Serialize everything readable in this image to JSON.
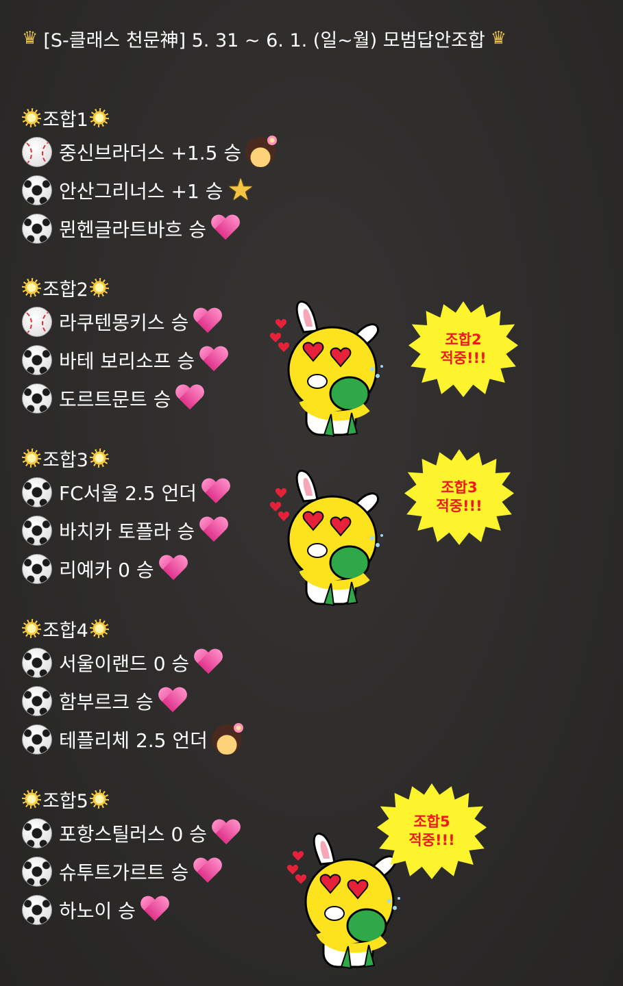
{
  "header": {
    "title": "[S-클래스 천문神] 5. 31 ~ 6. 1. (일~월) 모범답안조합"
  },
  "colors": {
    "background": "#2e2d2c",
    "text": "#ffffff",
    "burst": "#fef42d",
    "burst_text": "#ee1a1a",
    "heart": "#e0328a"
  },
  "sections": [
    {
      "label": "조합1",
      "picks": [
        {
          "sport": "baseball",
          "text": "중신브라더스 +1.5 승",
          "emoji": "girl-emoji"
        },
        {
          "sport": "soccer",
          "text": "안산그리너스 +1 승",
          "emoji": "star-emoji"
        },
        {
          "sport": "soccer",
          "text": "뮌헨글라트바흐 승",
          "emoji": "heart-emoji"
        }
      ]
    },
    {
      "label": "조합2",
      "picks": [
        {
          "sport": "baseball",
          "text": "라쿠텐몽키스 승",
          "emoji": "heart-emoji"
        },
        {
          "sport": "soccer",
          "text": "바테 보리소프 승",
          "emoji": "heart-emoji"
        },
        {
          "sport": "soccer",
          "text": "도르트문트 승",
          "emoji": "heart-emoji"
        }
      ]
    },
    {
      "label": "조합3",
      "picks": [
        {
          "sport": "soccer",
          "text": "FC서울 2.5 언더",
          "emoji": "heart-emoji"
        },
        {
          "sport": "soccer",
          "text": "바치카 토플라 승",
          "emoji": "heart-emoji"
        },
        {
          "sport": "soccer",
          "text": "리예카 0 승",
          "emoji": "heart-emoji"
        }
      ]
    },
    {
      "label": "조합4",
      "picks": [
        {
          "sport": "soccer",
          "text": "서울이랜드 0 승",
          "emoji": "heart-emoji"
        },
        {
          "sport": "soccer",
          "text": "함부르크 승",
          "emoji": "heart-emoji"
        },
        {
          "sport": "soccer",
          "text": "테플리체 2.5 언더",
          "emoji": "girl-emoji"
        }
      ]
    },
    {
      "label": "조합5",
      "picks": [
        {
          "sport": "soccer",
          "text": "포항스틸러스 0 승",
          "emoji": "heart-emoji"
        },
        {
          "sport": "soccer",
          "text": "슈투트가르트 승",
          "emoji": "heart-emoji"
        },
        {
          "sport": "soccer",
          "text": "하노이 승",
          "emoji": "heart-emoji"
        }
      ]
    }
  ],
  "badges": {
    "combo2": {
      "line1": "조합2",
      "line2": "적중!!!"
    },
    "combo3": {
      "line1": "조합3",
      "line2": "적중!!!"
    },
    "combo5": {
      "line1": "조합5",
      "line2": "적중!!!"
    }
  },
  "stickers": [
    "rabbit-hug-sticker",
    "rabbit-hug-sticker",
    "rabbit-hug-sticker"
  ]
}
